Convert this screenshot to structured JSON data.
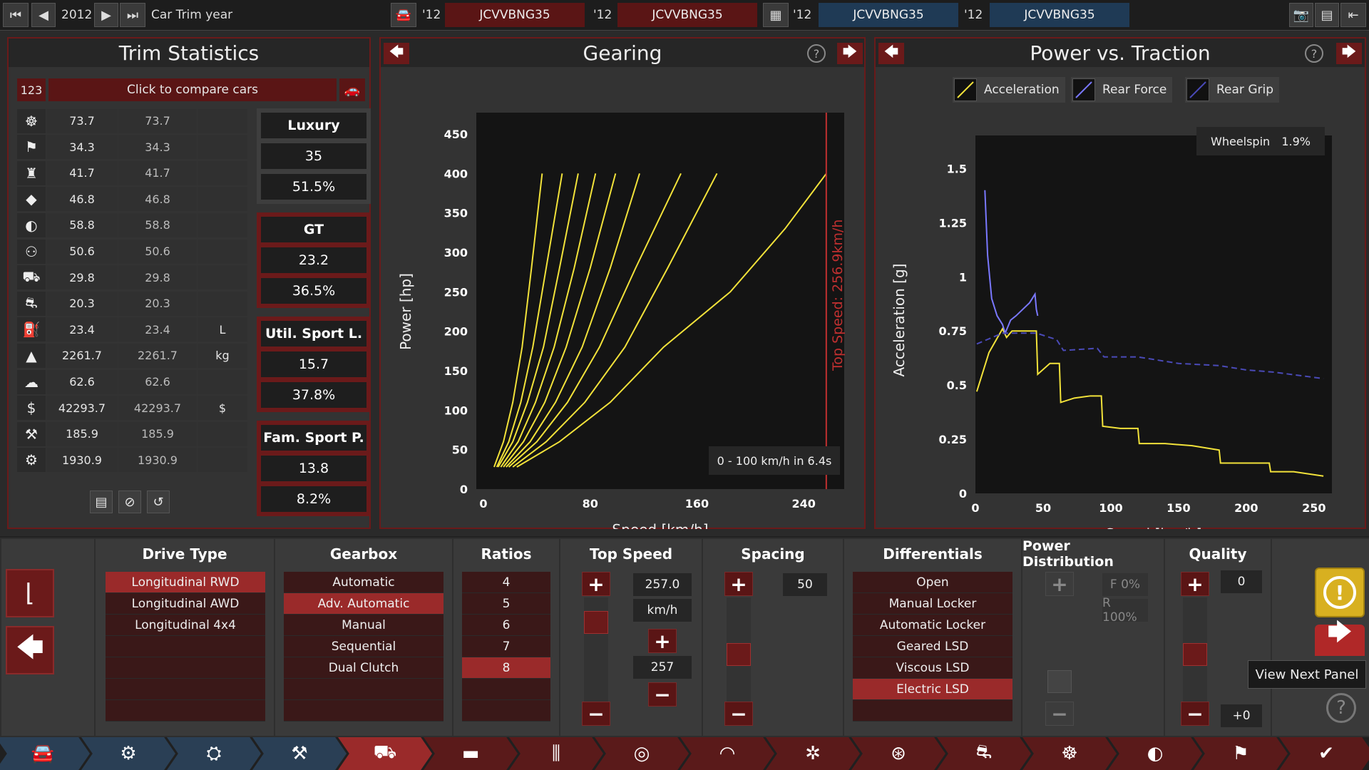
{
  "topbar": {
    "year": "2012",
    "mode_label": "Car Trim year",
    "slots": [
      {
        "year": "'12",
        "name": "JCVVBNG35"
      },
      {
        "year": "'12",
        "name": "JCVVBNG35"
      },
      {
        "year": "'12",
        "name": "JCVVBNG35"
      },
      {
        "year": "'12",
        "name": "JCVVBNG35"
      }
    ]
  },
  "trim_stats": {
    "title": "Trim Statistics",
    "compare_id": "123",
    "compare_label": "Click to compare cars",
    "rows": [
      {
        "icon": "steering-wheel-icon",
        "v1": "73.7",
        "v2": "73.7",
        "unit": ""
      },
      {
        "icon": "race-flag-icon",
        "v1": "34.3",
        "v2": "34.3",
        "unit": ""
      },
      {
        "icon": "seat-icon",
        "v1": "41.7",
        "v2": "41.7",
        "unit": ""
      },
      {
        "icon": "diamond-icon",
        "v1": "46.8",
        "v2": "46.8",
        "unit": ""
      },
      {
        "icon": "safety-icon",
        "v1": "58.8",
        "v2": "58.8",
        "unit": ""
      },
      {
        "icon": "people-icon",
        "v1": "50.6",
        "v2": "50.6",
        "unit": ""
      },
      {
        "icon": "cargo-car-icon",
        "v1": "29.8",
        "v2": "29.8",
        "unit": ""
      },
      {
        "icon": "offroad-car-icon",
        "v1": "20.3",
        "v2": "20.3",
        "unit": ""
      },
      {
        "icon": "fuel-icon",
        "v1": "23.4",
        "v2": "23.4",
        "unit": "L"
      },
      {
        "icon": "weight-icon",
        "v1": "2261.7",
        "v2": "2261.7",
        "unit": "kg"
      },
      {
        "icon": "emissions-icon",
        "v1": "62.6",
        "v2": "62.6",
        "unit": ""
      },
      {
        "icon": "cost-icon",
        "v1": "42293.7",
        "v2": "42293.7",
        "unit": "$"
      },
      {
        "icon": "service-icon",
        "v1": "185.9",
        "v2": "185.9",
        "unit": ""
      },
      {
        "icon": "engineering-icon",
        "v1": "1930.9",
        "v2": "1930.9",
        "unit": ""
      }
    ],
    "categories": [
      {
        "name": "Luxury",
        "score": "35",
        "percent": "51.5%"
      },
      {
        "name": "GT",
        "score": "23.2",
        "percent": "36.5%"
      },
      {
        "name": "Util. Sport L.",
        "score": "15.7",
        "percent": "37.8%"
      },
      {
        "name": "Fam. Sport P.",
        "score": "13.8",
        "percent": "8.2%"
      }
    ]
  },
  "gearing": {
    "title": "Gearing",
    "top_speed_label": "Top Speed: 256.9km/h",
    "accel_label": "0 - 100 km/h in 6.4s"
  },
  "power_traction": {
    "title": "Power vs. Traction",
    "legend": [
      "Acceleration",
      "Rear Force",
      "Rear Grip"
    ],
    "wheelspin_label": "Wheelspin",
    "wheelspin_value": "1.9%"
  },
  "chart_data": [
    {
      "type": "line",
      "title": "Gearing",
      "xlabel": "Speed [km/h]",
      "ylabel": "Power [hp]",
      "xlim": [
        0,
        265
      ],
      "ylim": [
        0,
        450
      ],
      "xticks": [
        "0",
        "80",
        "160",
        "240"
      ],
      "yticks": [
        "0",
        "50",
        "100",
        "150",
        "200",
        "250",
        "300",
        "350",
        "400",
        "450"
      ],
      "series_color": "#f2e23a",
      "series": [
        {
          "x": [
            8,
            15,
            22,
            29,
            36,
            44
          ],
          "y": [
            28,
            60,
            110,
            180,
            280,
            400
          ]
        },
        {
          "x": [
            10,
            19,
            28,
            37,
            47,
            59
          ],
          "y": [
            28,
            60,
            110,
            180,
            280,
            400
          ]
        },
        {
          "x": [
            11,
            22,
            33,
            45,
            57,
            71
          ],
          "y": [
            28,
            60,
            110,
            180,
            280,
            400
          ]
        },
        {
          "x": [
            13,
            26,
            39,
            53,
            68,
            84
          ],
          "y": [
            28,
            60,
            110,
            180,
            280,
            400
          ]
        },
        {
          "x": [
            15,
            30,
            46,
            62,
            80,
            99
          ],
          "y": [
            28,
            60,
            110,
            180,
            280,
            400
          ]
        },
        {
          "x": [
            17,
            35,
            54,
            74,
            95,
            117
          ],
          "y": [
            28,
            60,
            110,
            180,
            280,
            400
          ]
        },
        {
          "x": [
            19,
            40,
            63,
            87,
            114,
            148
          ],
          "y": [
            28,
            60,
            110,
            180,
            280,
            400
          ]
        },
        {
          "x": [
            22,
            47,
            76,
            106,
            138,
            175
          ],
          "y": [
            28,
            60,
            110,
            180,
            280,
            400
          ]
        },
        {
          "x": [
            25,
            57,
            95,
            135,
            185,
            226,
            257
          ],
          "y": [
            28,
            60,
            110,
            180,
            250,
            330,
            400
          ]
        }
      ],
      "top_speed": 256.9
    },
    {
      "type": "line",
      "title": "Power vs. Traction",
      "xlabel": "Speed [km/h]",
      "ylabel": "Acceleration [g]",
      "xlim": [
        0,
        258
      ],
      "ylim": [
        0,
        1.6
      ],
      "xticks": [
        "0",
        "50",
        "100",
        "150",
        "200",
        "250"
      ],
      "yticks": [
        "0",
        "0.25",
        "0.5",
        "0.75",
        "1",
        "1.25",
        "1.5"
      ],
      "series": [
        {
          "name": "Acceleration",
          "color": "#f2e23a",
          "x": [
            1,
            10,
            20,
            23,
            27,
            33,
            40,
            45,
            46,
            55,
            62,
            63,
            73,
            85,
            93,
            94,
            107,
            120,
            121,
            140,
            160,
            180,
            181,
            200,
            217,
            218,
            235,
            257
          ],
          "y": [
            0.47,
            0.65,
            0.76,
            0.72,
            0.75,
            0.75,
            0.75,
            0.75,
            0.55,
            0.6,
            0.6,
            0.42,
            0.44,
            0.45,
            0.45,
            0.31,
            0.3,
            0.3,
            0.23,
            0.23,
            0.22,
            0.2,
            0.14,
            0.14,
            0.14,
            0.1,
            0.1,
            0.08
          ]
        },
        {
          "name": "Rear Force",
          "color": "#7a78ff",
          "x": [
            7,
            9,
            12,
            16,
            20,
            22,
            26,
            30,
            35,
            40,
            44,
            45,
            46
          ],
          "y": [
            1.4,
            1.1,
            0.9,
            0.82,
            0.78,
            0.74,
            0.8,
            0.82,
            0.85,
            0.88,
            0.92,
            0.85,
            0.82
          ]
        },
        {
          "name": "Rear Grip",
          "color": "#4a4ab8",
          "x": [
            1,
            20,
            45,
            60,
            65,
            90,
            95,
            120,
            150,
            180,
            200,
            220,
            257
          ],
          "y": [
            0.69,
            0.74,
            0.74,
            0.71,
            0.66,
            0.67,
            0.63,
            0.63,
            0.6,
            0.59,
            0.57,
            0.56,
            0.53
          ]
        }
      ],
      "wheelspin": "1.9%"
    }
  ],
  "controls": {
    "drive_type": {
      "title": "Drive Type",
      "items": [
        "Longitudinal RWD",
        "Longitudinal AWD",
        "Longitudinal 4x4"
      ],
      "selected": 0
    },
    "gearbox": {
      "title": "Gearbox",
      "items": [
        "Automatic",
        "Adv. Automatic",
        "Manual",
        "Sequential",
        "Dual Clutch"
      ],
      "selected": 1
    },
    "ratios": {
      "title": "Ratios",
      "items": [
        "4",
        "5",
        "6",
        "7",
        "8"
      ],
      "selected": 4
    },
    "top_speed": {
      "title": "Top Speed",
      "value": "257.0",
      "unit": "km/h",
      "target": "257",
      "slider_level": 0.85
    },
    "spacing": {
      "title": "Spacing",
      "value": "50",
      "slider_level": 0.5
    },
    "differentials": {
      "title": "Differentials",
      "items": [
        "Open",
        "Manual Locker",
        "Automatic Locker",
        "Geared LSD",
        "Viscous LSD",
        "Electric LSD"
      ],
      "selected": 5
    },
    "power_distribution": {
      "title": "Power Distribution",
      "front": "F 0%",
      "rear": "R 100%",
      "slider_level": 0.2
    },
    "quality": {
      "title": "Quality",
      "value": "0",
      "delta": "+0",
      "slider_level": 0.5
    }
  },
  "tooltip": "View Next Panel",
  "bottom_nav": [
    "car-body-icon",
    "engine-parts-icon",
    "engine-block-icon",
    "engine-tune-icon",
    "drivetrain-icon",
    "chassis-icon",
    "suspension-icon",
    "brakes-icon",
    "tires-icon",
    "wheels-icon",
    "aero-icon",
    "fixtures-icon",
    "interior-icon",
    "safety-icon",
    "testing-icon",
    "finish-icon"
  ],
  "colors": {
    "accent": "#6b1a1a",
    "selected": "#9a2a2a",
    "warning": "#d8b020",
    "chart_line": "#f2e23a",
    "top_speed_line": "#c03030"
  }
}
